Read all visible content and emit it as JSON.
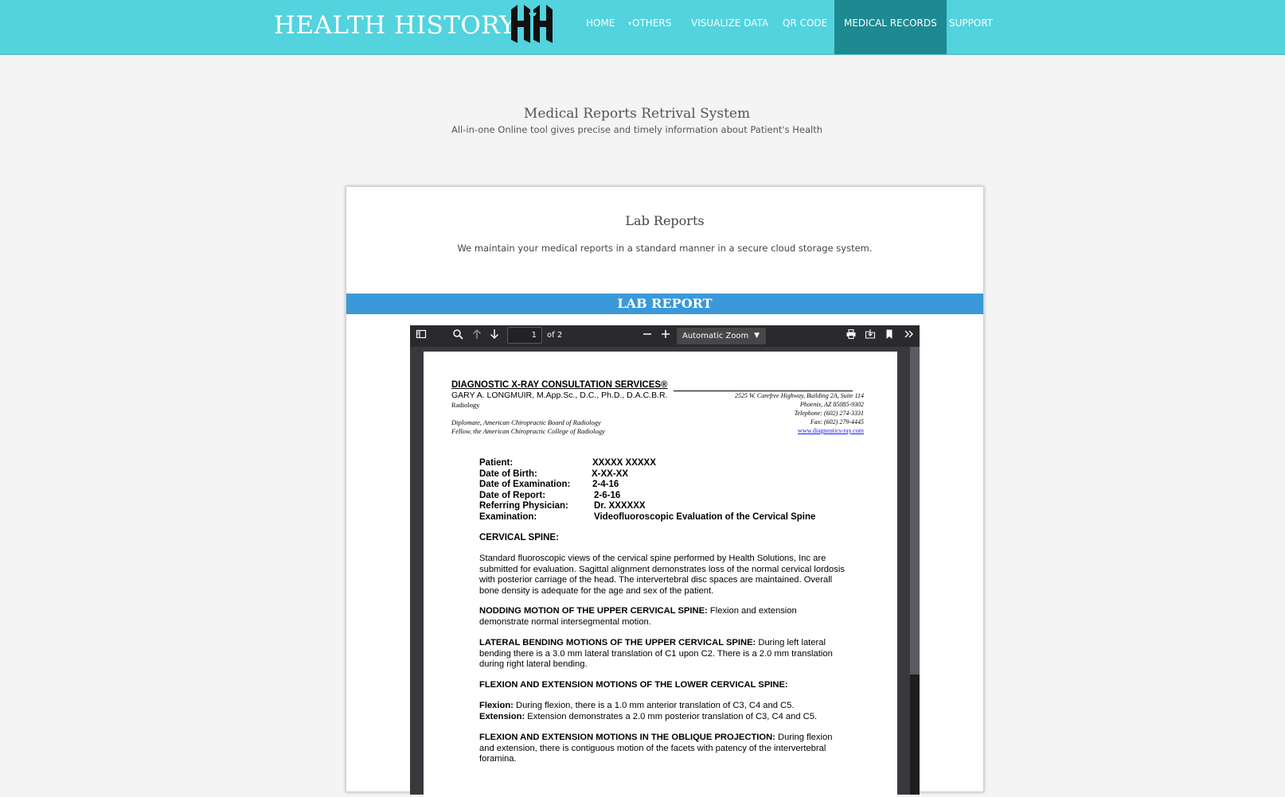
{
  "nav": {
    "brand": "HEALTH HISTORY",
    "items": [
      {
        "label": "HOME"
      },
      {
        "label": "OTHERS"
      },
      {
        "label": "VISUALIZE DATA"
      },
      {
        "label": "QR CODE"
      },
      {
        "label": "MEDICAL RECORDS",
        "active": true
      },
      {
        "label": "SUPPORT"
      }
    ]
  },
  "hero": {
    "title": "Medical Reports Retrival System",
    "subtitle": "All-in-one Online tool gives precise and timely information about Patient's Health"
  },
  "card": {
    "title": "Lab Reports",
    "subtitle": "We maintain your medical reports in a standard manner in a secure cloud storage system.",
    "band": "LAB REPORT"
  },
  "viewer": {
    "page_number": "1",
    "page_total": "of 2",
    "zoom": "Automatic Zoom"
  },
  "document": {
    "company": "DIAGNOSTIC X-RAY CONSULTATION SERVICES®",
    "doctor": "GARY A. LONGMUIR, M.App.Sc., D.C., Ph.D., D.A.C.B.R.",
    "specialty": "Radiology",
    "diplomate": "Diplomate, American Chiropractic Board of Radiology",
    "fellow": "Fellow, the American Chiropractic College of Radiology",
    "address1": "2525 W. Carefree Highway, Building 2A,  Suite 114",
    "address2": "Phoenix, AZ 85085-9302",
    "telephone": "Telephone: (602) 274-3331",
    "fax": "Fax: (602) 279-4445",
    "website": "www.diagnostics-ray.com",
    "fields": [
      {
        "label": "Patient:",
        "value": "XXXXX XXXXX"
      },
      {
        "label": "Date of Birth:",
        "value": "X-XX-XX"
      },
      {
        "label": "Date of Examination:",
        "value": "2-4-16"
      },
      {
        "label": "Date of Report:",
        "value": "2-6-16"
      },
      {
        "label": "Referring Physician:",
        "value": "Dr. XXXXXX"
      },
      {
        "label": "Examination:",
        "value": "Videofluoroscopic Evaluation of the Cervical Spine"
      }
    ],
    "section_cervical": "CERVICAL SPINE:",
    "para_standard": "Standard fluoroscopic views of the cervical spine performed by Health Solutions, Inc are submitted for evaluation. Sagittal alignment demonstrates loss of the normal cervical lordosis with posterior carriage of the head. The intervertebral disc spaces are maintained. Overall bone density is adequate for the age and sex of the patient.",
    "nodding_head": "NODDING MOTION OF THE UPPER CERVICAL SPINE:",
    "nodding_text": " Flexion and extension demonstrate normal intersegmental motion.",
    "lateral_head": "LATERAL BENDING MOTIONS OF THE UPPER CERVICAL SPINE:",
    "lateral_text": " During left lateral bending there is a 3.0 mm lateral translation of C1 upon C2. There is a 2.0 mm translation during right lateral bending.",
    "flexlower_head": "FLEXION AND EXTENSION MOTIONS OF THE LOWER CERVICAL SPINE:",
    "flexion_head": "Flexion:",
    "flexion_text": " During flexion, there is a 1.0 mm anterior translation of C3, C4 and C5.",
    "extension_head": "Extension:",
    "extension_text": " Extension demonstrates a 2.0 mm posterior translation of C3, C4 and C5.",
    "oblique_head": "FLEXION AND EXTENSION MOTIONS IN THE OBLIQUE PROJECTION:",
    "oblique_text": " During flexion and extension, there is contiguous motion of the facets with patency of the intervertebral foramina."
  }
}
